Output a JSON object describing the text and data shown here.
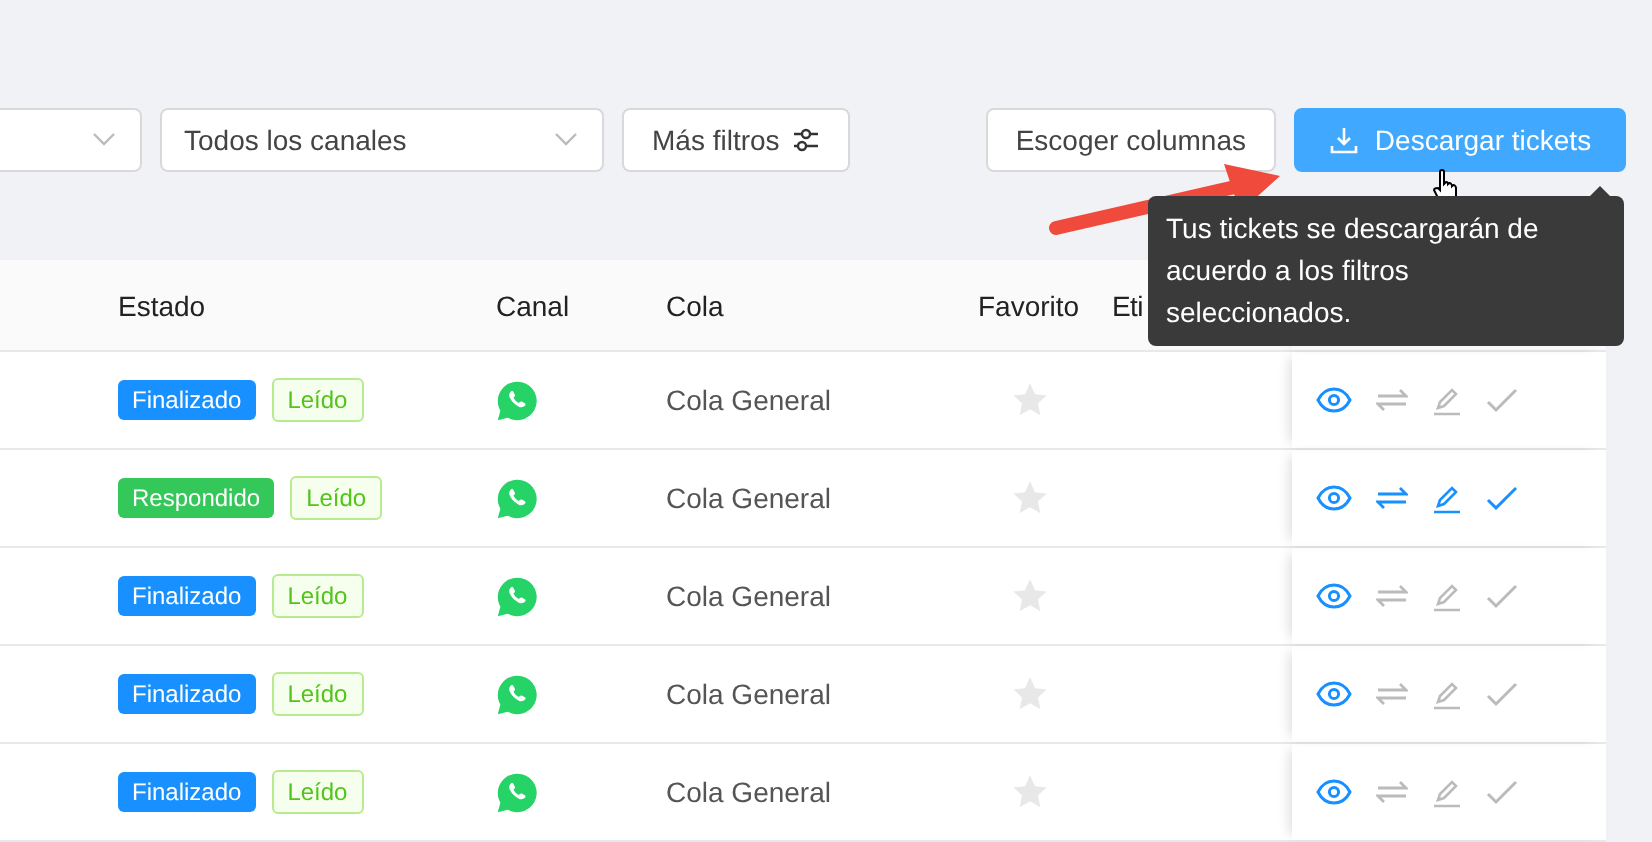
{
  "filters": [
    {
      "kind": "select"
    },
    {
      "kind": "select",
      "value": "Todos los canales"
    },
    {
      "kind": "button",
      "value": "Más filtros"
    }
  ],
  "actions": [
    {
      "label": "Escoger columnas",
      "primary": false
    },
    {
      "label": "Descargar tickets",
      "primary": true
    }
  ],
  "tooltip": {
    "text": "Tus tickets se descargarán de acuerdo a los filtros seleccionados."
  },
  "table": {
    "columns": [
      "Estado",
      "Canal",
      "Cola",
      "Favorito",
      "Eti"
    ],
    "rows": [
      {
        "status": "Finalizado",
        "color": "#1890ff",
        "read": "Leído",
        "queue": "Cola General",
        "favorite": false,
        "actions_enabled": false
      },
      {
        "status": "Respondido",
        "color": "#34c759",
        "read": "Leído",
        "queue": "Cola General",
        "favorite": false,
        "actions_enabled": true
      },
      {
        "status": "Finalizado",
        "color": "#1890ff",
        "read": "Leído",
        "queue": "Cola General",
        "favorite": false,
        "actions_enabled": false
      },
      {
        "status": "Finalizado",
        "color": "#1890ff",
        "read": "Leído",
        "queue": "Cola General",
        "favorite": false,
        "actions_enabled": false
      },
      {
        "status": "Finalizado",
        "color": "#1890ff",
        "read": "Leído",
        "queue": "Cola General",
        "favorite": false,
        "actions_enabled": false
      }
    ]
  }
}
